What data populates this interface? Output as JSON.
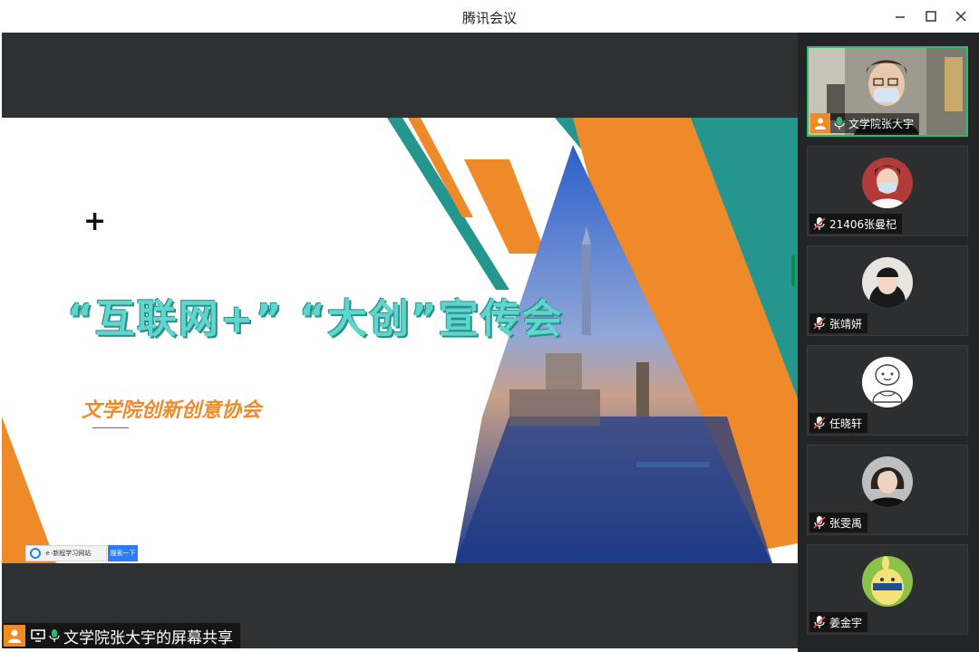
{
  "window": {
    "title": "腾讯会议",
    "controls": [
      "minimize-icon",
      "maximize-icon",
      "close-icon"
    ]
  },
  "slide": {
    "main_title": "“互联网+”  “大创”宣传会",
    "subtitle": "文学院创新创意协会",
    "plus_mark": "+",
    "browser_bar": {
      "input_text": "ｅ·新程学习网站",
      "button_label": "搜索一下"
    },
    "colors": {
      "orange": "#ef8a2a",
      "teal": "#25968d",
      "title_teal": "#5fd6cd"
    }
  },
  "share_status": {
    "label": "文学院张大宇的屏幕共享"
  },
  "participants": [
    {
      "name": "文学院张大宇",
      "mic": "on",
      "camera": "on",
      "host": true
    },
    {
      "name": "21406张曼杞",
      "mic": "muted",
      "camera": "off"
    },
    {
      "name": "张靖妍",
      "mic": "muted",
      "camera": "off"
    },
    {
      "name": "任晓轩",
      "mic": "muted",
      "camera": "off"
    },
    {
      "name": "张雯禹",
      "mic": "muted",
      "camera": "off"
    },
    {
      "name": "姜金宇",
      "mic": "muted",
      "camera": "off"
    }
  ]
}
